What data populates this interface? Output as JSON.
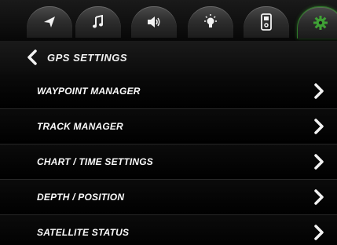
{
  "tabs": [
    {
      "icon": "navigation-arrow-icon",
      "active": false
    },
    {
      "icon": "music-note-icon",
      "active": false
    },
    {
      "icon": "speaker-icon",
      "active": false
    },
    {
      "icon": "light-bulb-icon",
      "active": false
    },
    {
      "icon": "remote-device-icon",
      "active": false
    },
    {
      "icon": "gear-icon",
      "active": true
    }
  ],
  "colors": {
    "accent_green": "#3fa035",
    "text": "#ffffff",
    "background": "#000000"
  },
  "header": {
    "title": "GPS SETTINGS",
    "back_icon": "chevron-left-icon"
  },
  "menu": {
    "items": [
      {
        "label": "WAYPOINT MANAGER"
      },
      {
        "label": "TRACK MANAGER"
      },
      {
        "label": "CHART / TIME SETTINGS"
      },
      {
        "label": "DEPTH / POSITION"
      },
      {
        "label": "SATELLITE STATUS"
      }
    ],
    "item_icon": "chevron-right-icon"
  }
}
